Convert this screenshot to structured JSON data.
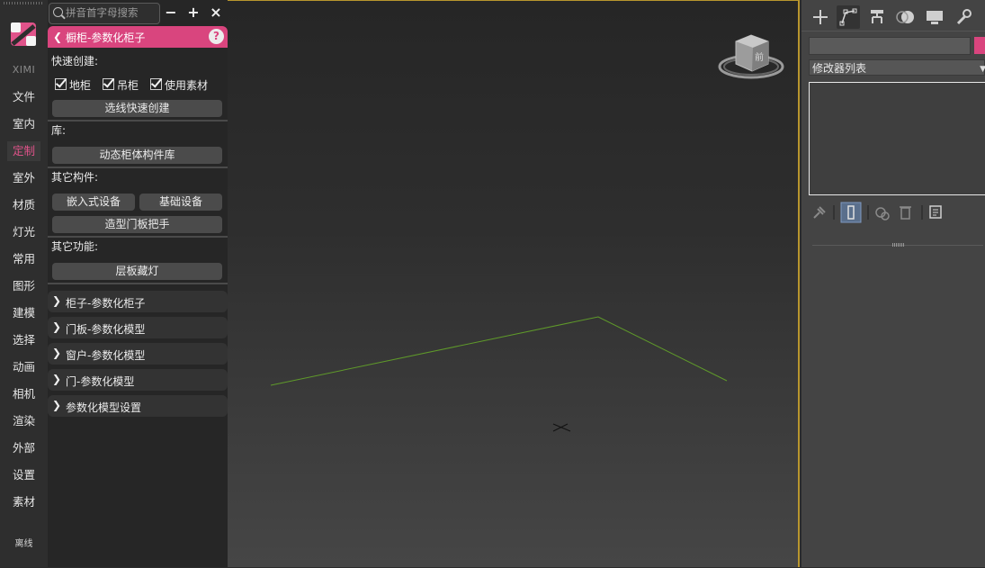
{
  "nav": {
    "brand": "XIMI",
    "items": [
      "文件",
      "室内",
      "定制",
      "室外",
      "材质",
      "灯光",
      "常用",
      "图形",
      "建模",
      "选择",
      "动画",
      "相机",
      "渲染",
      "外部",
      "设置",
      "素材"
    ],
    "active_index": 2,
    "offline": "离线"
  },
  "panel": {
    "search_placeholder": "拼音首字母搜索",
    "minus": "−",
    "plus": "+",
    "close": "×",
    "section_title": "橱柜-参数化柜子",
    "help": "?",
    "quick_create_label": "快速创建:",
    "checkboxes": [
      {
        "label": "地柜",
        "checked": true
      },
      {
        "label": "吊柜",
        "checked": true
      },
      {
        "label": "使用素材",
        "checked": true
      }
    ],
    "btn_quick_create": "选线快速创建",
    "lib_label": "库:",
    "btn_dynamic_lib": "动态柜体构件库",
    "other_parts_label": "其它构件:",
    "btn_embedded": "嵌入式设备",
    "btn_basic": "基础设备",
    "btn_handle": "造型门板把手",
    "other_funcs_label": "其它功能:",
    "btn_shelf_light": "层板藏灯",
    "collapsed_sections": [
      "柜子-参数化柜子",
      "门板-参数化模型",
      "窗户-参数化模型",
      "门-参数化模型",
      "参数化模型设置"
    ]
  },
  "viewport": {
    "viewcube_label": "前"
  },
  "command_panel": {
    "modifier_list": "修改器列表",
    "accent": "#d9457e"
  }
}
